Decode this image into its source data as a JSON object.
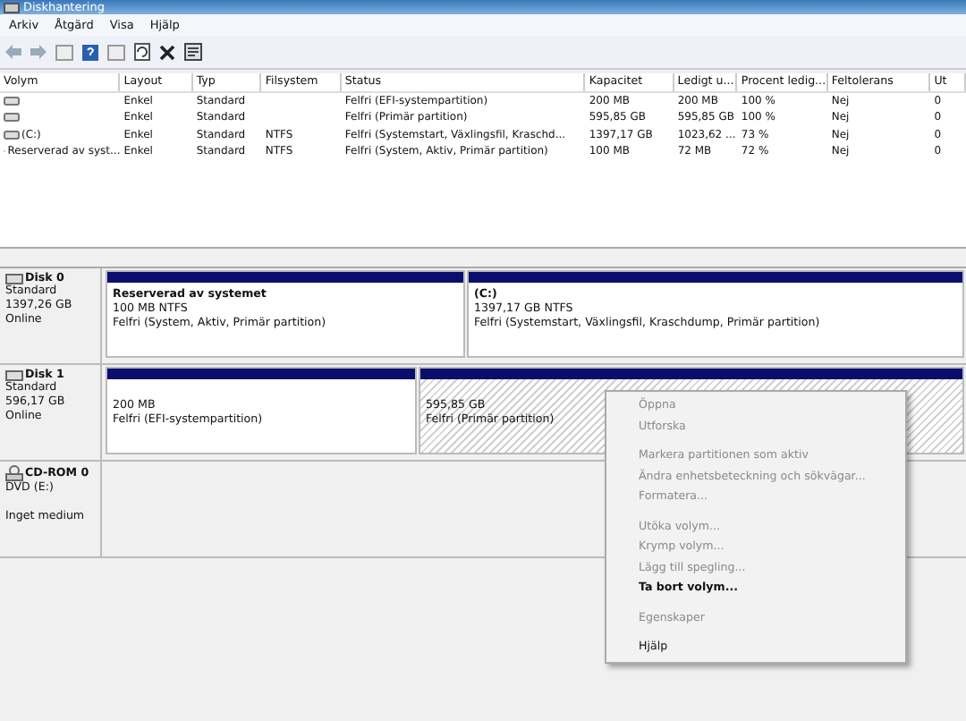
{
  "window": {
    "title": "Diskhantering"
  },
  "menu": [
    "Arkiv",
    "Åtgärd",
    "Visa",
    "Hjälp"
  ],
  "table": {
    "columns": [
      "Volym",
      "Layout",
      "Typ",
      "Filsystem",
      "Status",
      "Kapacitet",
      "Ledigt u...",
      "Procent ledig...",
      "Feltolerans",
      "Ut"
    ],
    "rows": [
      {
        "cells": [
          "",
          "Enkel",
          "Standard",
          "",
          "Felfri (EFI-systempartition)",
          "200 MB",
          "200 MB",
          "100 %",
          "Nej",
          "0"
        ]
      },
      {
        "cells": [
          "",
          "Enkel",
          "Standard",
          "",
          "Felfri (Primär partition)",
          "595,85 GB",
          "595,85 GB",
          "100 %",
          "Nej",
          "0"
        ]
      },
      {
        "cells": [
          "(C:)",
          "Enkel",
          "Standard",
          "NTFS",
          "Felfri (Systemstart, Växlingsfil, Kraschd...",
          "1397,17 GB",
          "1023,62 ...",
          "73 %",
          "Nej",
          "0"
        ]
      },
      {
        "cells": [
          "Reserverad av syst...",
          "Enkel",
          "Standard",
          "NTFS",
          "Felfri (System, Aktiv, Primär partition)",
          "100 MB",
          "72 MB",
          "72 %",
          "Nej",
          "0"
        ]
      }
    ]
  },
  "disks": [
    {
      "kind": "disk",
      "name": "Disk 0",
      "lines": [
        "Standard",
        "1397,26 GB",
        "Online"
      ],
      "partitions": [
        {
          "kind": "normal",
          "title": "Reserverad av systemet",
          "lines": [
            "100 MB NTFS",
            "Felfri (System, Aktiv, Primär partition)"
          ]
        },
        {
          "kind": "normal",
          "title": "(C:)",
          "lines": [
            "1397,17 GB NTFS",
            "Felfri (Systemstart, Växlingsfil, Kraschdump, Primär partition)"
          ]
        }
      ]
    },
    {
      "kind": "disk",
      "name": "Disk 1",
      "lines": [
        "Standard",
        "596,17 GB",
        "Online"
      ],
      "partitions": [
        {
          "kind": "normal",
          "lines": [
            "200 MB",
            "Felfri (EFI-systempartition)"
          ]
        },
        {
          "kind": "hatched",
          "lines": [
            "595,85 GB",
            "Felfri (Primär partition)"
          ]
        }
      ]
    },
    {
      "kind": "cdrom",
      "name": "CD-ROM 0",
      "lines": [
        "DVD (E:)",
        "Inget medium"
      ]
    }
  ],
  "context_menu": [
    {
      "kind": "item",
      "label": "Öppna",
      "disabled": true
    },
    {
      "kind": "item",
      "label": "Utforska",
      "disabled": true
    },
    {
      "kind": "separator"
    },
    {
      "kind": "item",
      "label": "Markera partitionen som aktiv",
      "disabled": true
    },
    {
      "kind": "item",
      "label": "Ändra enhetsbeteckning och sökvägar...",
      "disabled": true
    },
    {
      "kind": "item",
      "label": "Formatera...",
      "disabled": true
    },
    {
      "kind": "separator"
    },
    {
      "kind": "item",
      "label": "Utöka volym...",
      "disabled": true
    },
    {
      "kind": "item",
      "label": "Krymp volym...",
      "disabled": true
    },
    {
      "kind": "item",
      "label": "Lägg till spegling...",
      "disabled": true
    },
    {
      "kind": "item",
      "label": "Ta bort volym...",
      "disabled": false
    },
    {
      "kind": "separator"
    },
    {
      "kind": "item",
      "label": "Egenskaper",
      "disabled": true
    },
    {
      "kind": "separator"
    },
    {
      "kind": "item",
      "label": "Hjälp",
      "disabled": false
    }
  ]
}
